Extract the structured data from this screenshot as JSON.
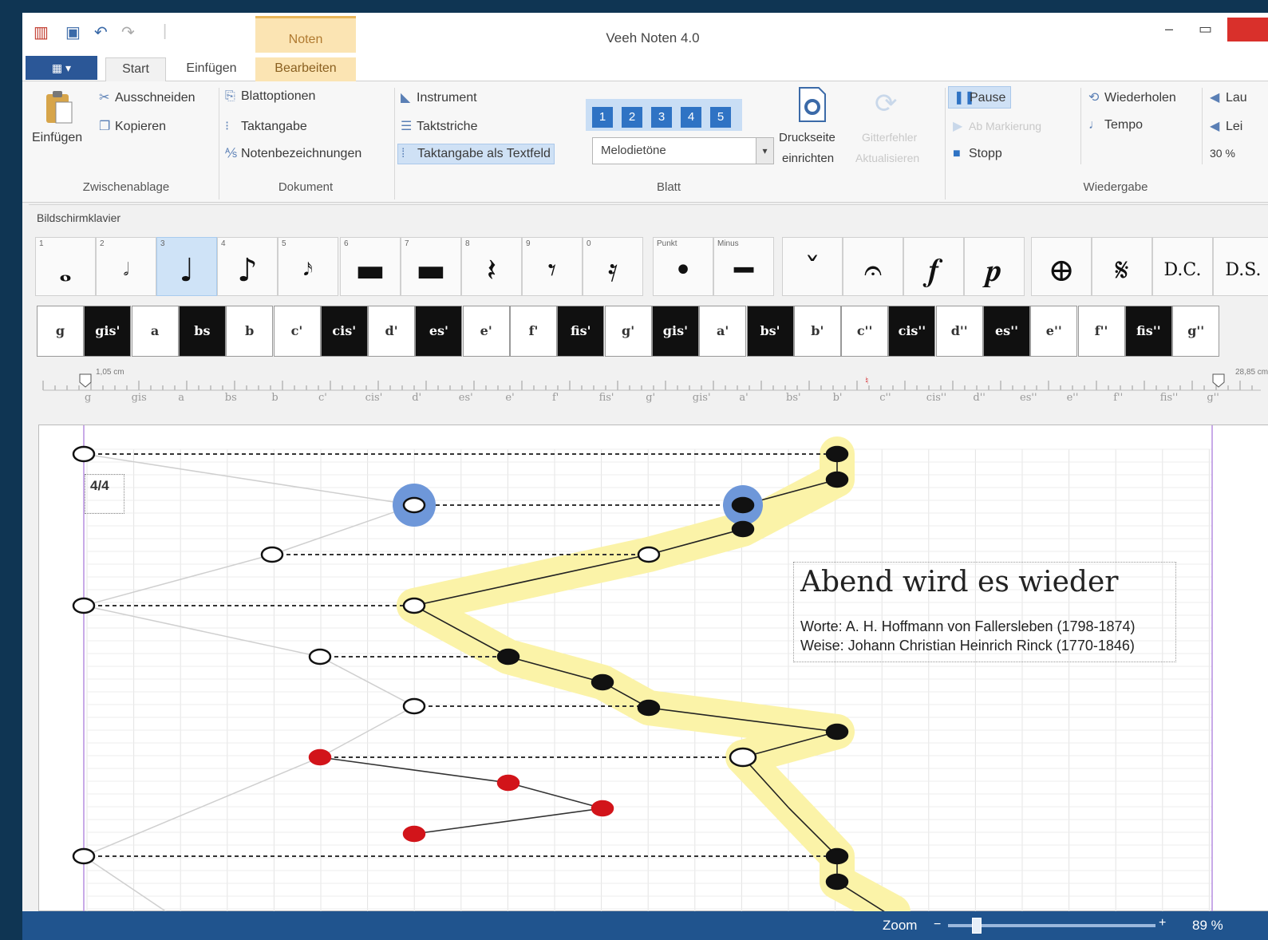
{
  "app": {
    "title": "Veeh Noten 4.0",
    "context_tab_group": "Noten",
    "file_button": "▦ ▾",
    "tabs": [
      "Start",
      "Einfügen",
      "Bearbeiten"
    ]
  },
  "ribbon": {
    "zwischenablage": {
      "label": "Zwischenablage",
      "einfuegen": "Einfügen",
      "ausschneiden": "Ausschneiden",
      "kopieren": "Kopieren"
    },
    "dokument": {
      "label": "Dokument",
      "blattoptionen": "Blattoptionen",
      "taktangabe": "Taktangabe",
      "notenbezeichnungen": "Notenbezeichnungen"
    },
    "blatt": {
      "label": "Blatt",
      "instrument": "Instrument",
      "taktstriche": "Taktstriche",
      "taktangabe_textfeld": "Taktangabe als Textfeld",
      "numbers": [
        "1",
        "2",
        "3",
        "4",
        "5"
      ],
      "melodietoene": "Melodietöne",
      "druckseite": "Druckseite",
      "einrichten": "einrichten",
      "gitterfehler": "Gitterfehler",
      "aktualisieren": "Aktualisieren"
    },
    "wiedergabe": {
      "label": "Wiedergabe",
      "pause": "Pause",
      "ab_markierung": "Ab Markierung",
      "stopp": "Stopp",
      "wiederholen": "Wiederholen",
      "tempo": "Tempo",
      "laut": "Lau",
      "leise": "Lei",
      "percent": "30 %"
    }
  },
  "panel": {
    "title": "Bildschirmklavier",
    "note_buttons": [
      {
        "num": "1",
        "glyph": "𝅝"
      },
      {
        "num": "2",
        "glyph": "𝅗𝅥"
      },
      {
        "num": "3",
        "glyph": "♩"
      },
      {
        "num": "4",
        "glyph": "♪"
      },
      {
        "num": "5",
        "glyph": "𝅘𝅥𝅯"
      },
      {
        "num": "6",
        "glyph": "▬"
      },
      {
        "num": "7",
        "glyph": "▬"
      },
      {
        "num": "8",
        "glyph": "𝄽"
      },
      {
        "num": "9",
        "glyph": "𝄾"
      },
      {
        "num": "0",
        "glyph": "𝄿"
      },
      {
        "num": "Punkt",
        "glyph": "•"
      },
      {
        "num": "Minus",
        "glyph": "━"
      },
      {
        "num": "",
        "glyph": "ˇ"
      },
      {
        "num": "",
        "glyph": "𝄐"
      },
      {
        "num": "",
        "glyph": "𝆑"
      },
      {
        "num": "",
        "glyph": "𝆏"
      },
      {
        "num": "",
        "glyph": "⊕"
      },
      {
        "num": "",
        "glyph": "𝄋"
      },
      {
        "num": "",
        "glyph": "D.C."
      },
      {
        "num": "",
        "glyph": "D.S."
      }
    ],
    "keys": [
      "g",
      "gis'",
      "a",
      "bs",
      "b",
      "c'",
      "cis'",
      "d'",
      "es'",
      "e'",
      "f'",
      "fis'",
      "g'",
      "gis'",
      "a'",
      "bs'",
      "b'",
      "c''",
      "cis''",
      "d''",
      "es''",
      "e''",
      "f''",
      "fis''",
      "g''"
    ],
    "ruler_labels": [
      "g",
      "gis",
      "a",
      "bs",
      "b",
      "c'",
      "cis'",
      "d'",
      "es'",
      "e'",
      "f'",
      "fis'",
      "g'",
      "gis'",
      "a'",
      "bs'",
      "b'",
      "c''",
      "cis''",
      "d''",
      "es''",
      "e''",
      "f''",
      "fis''",
      "g''"
    ],
    "ruler_left": "1,05 cm",
    "ruler_right": "28,85 cm"
  },
  "sheet": {
    "time_signature": "4/4",
    "song_title": "Abend wird es wieder",
    "worte": "Worte: A. H. Hoffmann von Fallersleben (1798-1874)",
    "weise": "Weise: Johann Christian Heinrich Rinck (1770-1846)",
    "colors": {
      "highlight": "#fbf3a8",
      "selected": "#6e97d9",
      "red": "#d2141a"
    }
  },
  "status": {
    "zoom_label": "Zoom",
    "zoom_value": "89 %",
    "zoom_level": 0.12
  }
}
